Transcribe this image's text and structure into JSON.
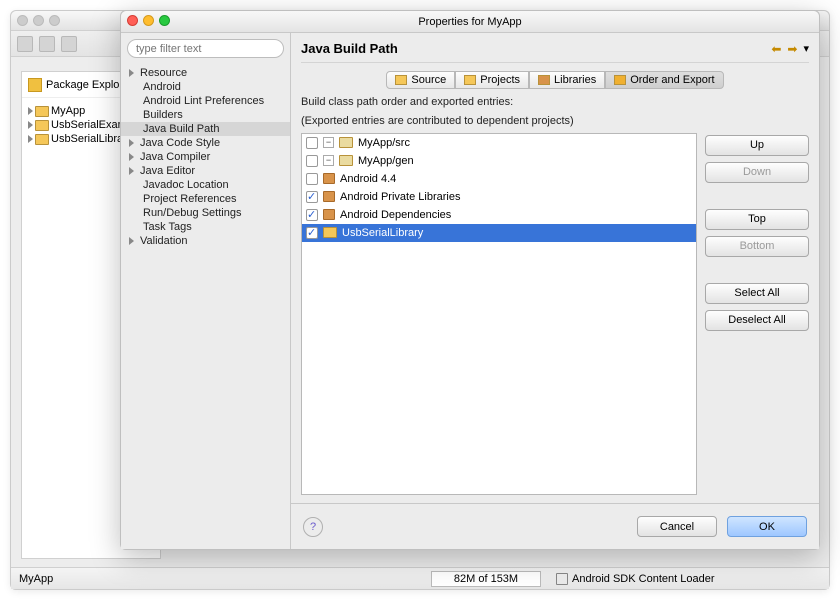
{
  "eclipse": {
    "package_explorer_title": "Package Explorer",
    "projects": [
      "MyApp",
      "UsbSerialExamples",
      "UsbSerialLibrary"
    ],
    "status_project": "MyApp",
    "heap_text": "82M of 153M",
    "android_loader": "Android SDK Content Loader"
  },
  "dialog": {
    "title": "Properties for MyApp",
    "filter_placeholder": "type filter text",
    "tree": [
      {
        "label": "Resource",
        "depth": 0,
        "expander": true
      },
      {
        "label": "Android",
        "depth": 1
      },
      {
        "label": "Android Lint Preferences",
        "depth": 1
      },
      {
        "label": "Builders",
        "depth": 1
      },
      {
        "label": "Java Build Path",
        "depth": 1,
        "selected": true
      },
      {
        "label": "Java Code Style",
        "depth": 0,
        "expander": true
      },
      {
        "label": "Java Compiler",
        "depth": 0,
        "expander": true
      },
      {
        "label": "Java Editor",
        "depth": 0,
        "expander": true
      },
      {
        "label": "Javadoc Location",
        "depth": 1
      },
      {
        "label": "Project References",
        "depth": 1
      },
      {
        "label": "Run/Debug Settings",
        "depth": 1
      },
      {
        "label": "Task Tags",
        "depth": 1
      },
      {
        "label": "Validation",
        "depth": 0,
        "expander": true
      }
    ],
    "header": "Java Build Path",
    "tabs": [
      {
        "label": "Source",
        "icon": "source"
      },
      {
        "label": "Projects",
        "icon": "projects"
      },
      {
        "label": "Libraries",
        "icon": "libraries"
      },
      {
        "label": "Order and Export",
        "icon": "order",
        "active": true
      }
    ],
    "desc_line1": "Build class path order and exported entries:",
    "desc_line2": "(Exported entries are contributed to dependent projects)",
    "entries": [
      {
        "label": "MyApp/src",
        "checked": false,
        "collapsible": true,
        "icon": "package"
      },
      {
        "label": "MyApp/gen",
        "checked": false,
        "collapsible": true,
        "icon": "package"
      },
      {
        "label": "Android 4.4",
        "checked": false,
        "collapsible": false,
        "icon": "jar"
      },
      {
        "label": "Android Private Libraries",
        "checked": true,
        "collapsible": false,
        "icon": "jar"
      },
      {
        "label": "Android Dependencies",
        "checked": true,
        "collapsible": false,
        "icon": "jar"
      },
      {
        "label": "UsbSerialLibrary",
        "checked": true,
        "collapsible": false,
        "icon": "folder",
        "selected": true
      }
    ],
    "buttons": {
      "up": "Up",
      "down": "Down",
      "top": "Top",
      "bottom": "Bottom",
      "select_all": "Select All",
      "deselect_all": "Deselect All"
    },
    "cancel": "Cancel",
    "ok": "OK"
  }
}
